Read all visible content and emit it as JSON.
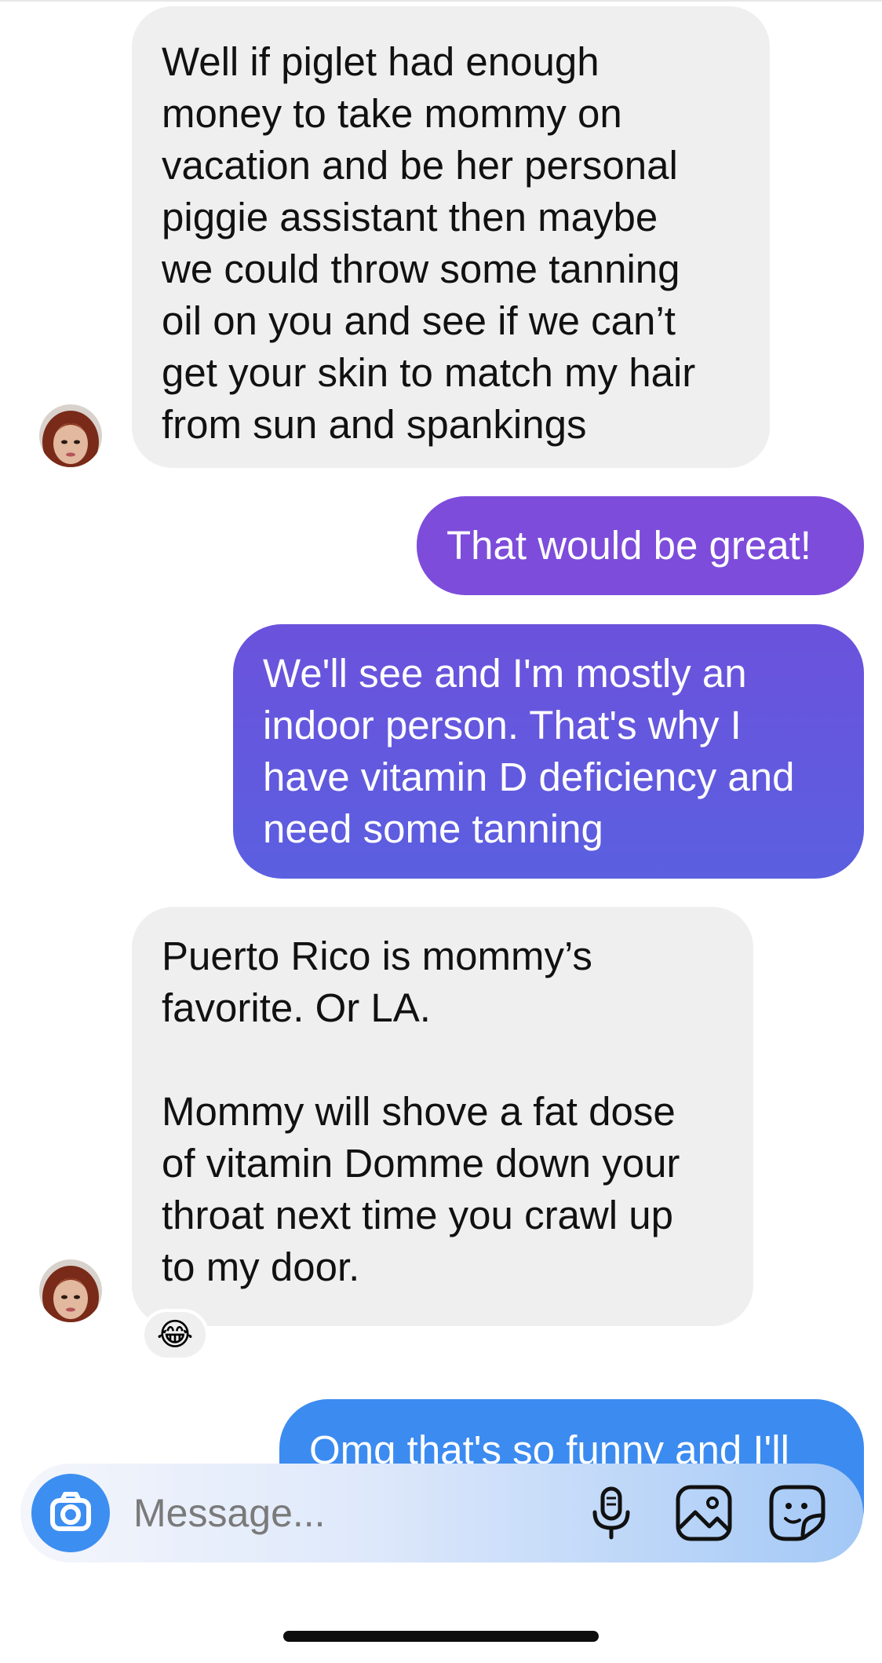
{
  "messages": [
    {
      "direction": "received",
      "text": "Well if piglet had enough\nmoney to take mommy on\nvacation and be her personal\npiggie assistant then maybe\nwe could throw some tanning\noil on you and see if we can’t\nget your skin to match my hair\nfrom sun and spankings"
    },
    {
      "direction": "sent",
      "text": "That would be great!"
    },
    {
      "direction": "sent",
      "text": "We'll see and I'm mostly an\nindoor person. That's why I\nhave vitamin D deficiency and\nneed some tanning"
    },
    {
      "direction": "received",
      "text": "Puerto Rico is mommy’s\nfavorite. Or LA.\n\nMommy will shove a fat dose\nof vitamin Domme down your\nthroat next time you crawl up\nto my door.",
      "reaction": "😂"
    },
    {
      "direction": "sent",
      "text": "Omg that's so funny and I'll"
    }
  ],
  "composer": {
    "placeholder": "Message...",
    "icons": [
      "camera-icon",
      "microphone-icon",
      "gallery-icon",
      "sticker-icon"
    ]
  },
  "colors": {
    "received_bubble": "#efefef",
    "sent_gradient_top": "#7c4ddb",
    "sent_gradient_bottom": "#3c8bf0",
    "accent_blue": "#3d8ef1"
  }
}
